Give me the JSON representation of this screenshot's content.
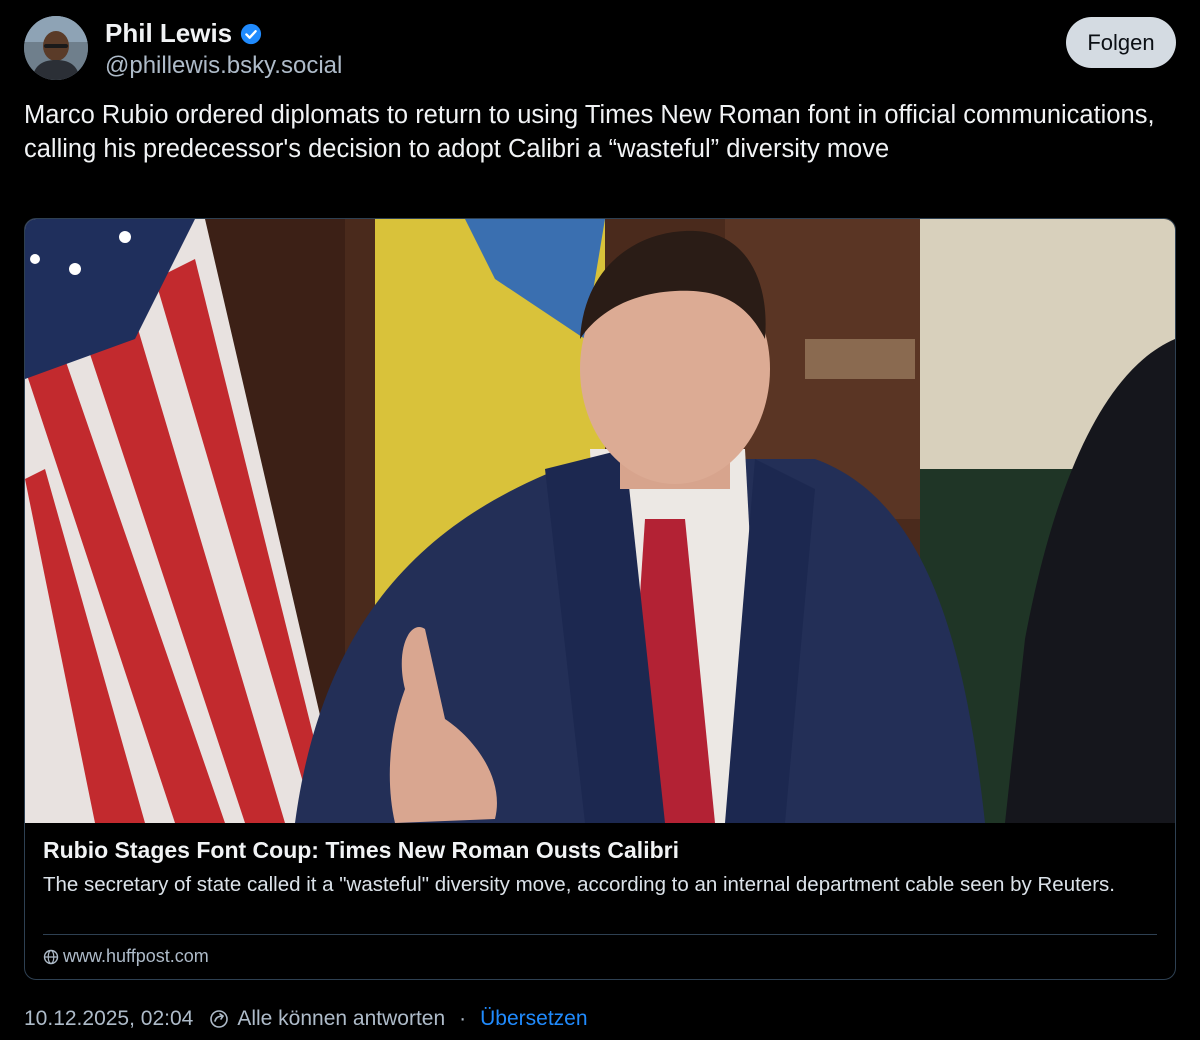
{
  "author": {
    "display_name": "Phil Lewis",
    "handle": "@phillewis.bsky.social",
    "verified_icon": "verified-check-icon",
    "verified_color": "#208bfe"
  },
  "follow_button": {
    "label": "Folgen"
  },
  "post": {
    "text": "Marco Rubio ordered diplomats to return to using Times New Roman font in official communications, calling his predecessor's decision to adopt Calibri a “wasteful” diversity move"
  },
  "embed": {
    "title": "Rubio Stages Font Coup: Times New Roman Ousts Calibri",
    "description": "The secretary of state called it a \"wasteful\" diversity move, according to an internal department cable seen by Reuters.",
    "domain": "www.huffpost.com",
    "domain_icon": "globe-icon"
  },
  "meta": {
    "timestamp": "10.12.2025, 02:04",
    "reply_setting": "Alle können antworten",
    "separator": "·",
    "translate_label": "Übersetzen",
    "link_color": "#208bfe"
  },
  "colors": {
    "background": "#000000",
    "text_primary": "#f1f3f5",
    "text_secondary": "#aebbc9",
    "border": "#2e4052",
    "button_bg": "#d4dbe2"
  }
}
